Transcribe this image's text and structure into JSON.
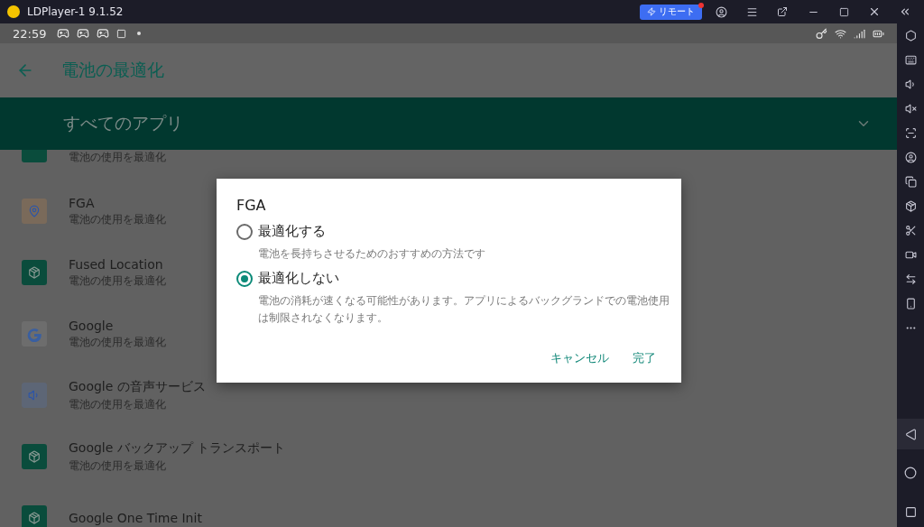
{
  "window": {
    "title": "LDPlayer-1 9.1.52",
    "remote_button": "リモート",
    "remote_badge": true
  },
  "status_bar": {
    "time": "22:59"
  },
  "app_bar": {
    "title": "電池の最適化"
  },
  "filter": {
    "label": "すべてのアプリ"
  },
  "apps": [
    {
      "kind": "android",
      "subtitle": "電池の使用を最適化"
    },
    {
      "kind": "game",
      "name": "FGA",
      "subtitle": "電池の使用を最適化"
    },
    {
      "kind": "android",
      "name": "Fused Location",
      "subtitle": "電池の使用を最適化"
    },
    {
      "kind": "google",
      "name": "Google",
      "subtitle": "電池の使用を最適化"
    },
    {
      "kind": "voice",
      "name": "Google の音声サービス",
      "subtitle": "電池の使用を最適化"
    },
    {
      "kind": "android",
      "name": "Google バックアップ トランスポート",
      "subtitle": "電池の使用を最適化"
    },
    {
      "kind": "android",
      "name": "Google One Time Init"
    }
  ],
  "dialog": {
    "title": "FGA",
    "options": [
      {
        "label": "最適化する",
        "description": "電池を長持ちさせるためのおすすめの方法です",
        "selected": false
      },
      {
        "label": "最適化しない",
        "description": "電池の消耗が速くなる可能性があります。アプリによるバックグランドでの電池使用は制限されなくなります。",
        "selected": true
      }
    ],
    "buttons": [
      "キャンセル",
      "完了"
    ]
  }
}
